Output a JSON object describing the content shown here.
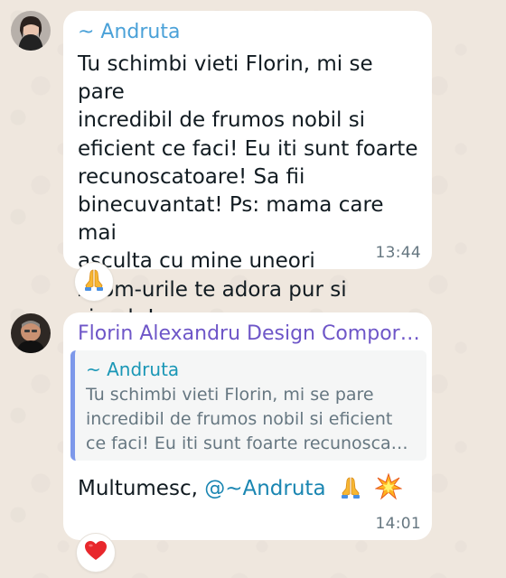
{
  "messages": [
    {
      "sender": "~ Andruta",
      "sender_color": "#4aa1d8",
      "text_lines": [
        "Tu schimbi vieti Florin, mi se pare",
        "incredibil de frumos nobil si",
        "eficient ce faci! Eu iti sunt foarte",
        "recunoscatoare! Sa fii",
        "binecuvantat! Ps: mama care mai",
        "asculta cu mine uneori",
        "zoom-urile te adora pur si",
        "simplu!"
      ],
      "time": "13:44",
      "reaction_icon": "folded-hands-icon"
    },
    {
      "sender": "Florin Alexandru Design Comporta…",
      "sender_color": "#6e56c8",
      "quote": {
        "sender": "~ Andruta",
        "text_lines": [
          "Tu schimbi vieti Florin, mi se pare",
          "incredibil de frumos nobil si eficient",
          "ce faci! Eu iti sunt foarte recunosca…"
        ]
      },
      "text": "Multumesc, ",
      "mention": "@~Andruta",
      "inline_icons": [
        "folded-hands-icon",
        "collision-icon"
      ],
      "time": "14:01",
      "reaction_icon": "red-heart-icon"
    }
  ]
}
